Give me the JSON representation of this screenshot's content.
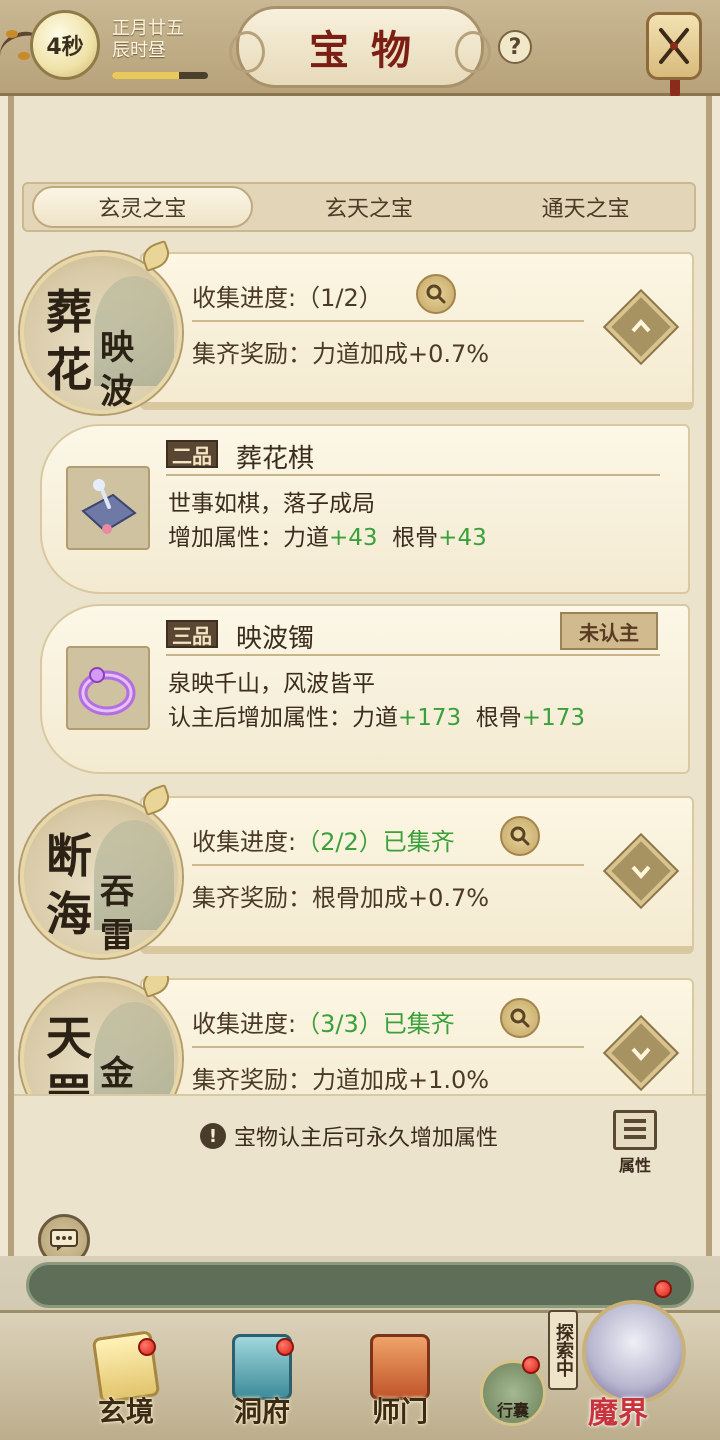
{
  "header": {
    "timer": "4秒",
    "date_line1": "正月廿五",
    "date_line2": "辰时昼",
    "time_progress": 0.7,
    "title": "宝物",
    "help_label": "?"
  },
  "tabs": [
    {
      "label": "玄灵之宝",
      "active": true
    },
    {
      "label": "玄天之宝",
      "active": false
    },
    {
      "label": "通天之宝",
      "active": false
    }
  ],
  "collections": [
    {
      "name_chars": [
        "葬",
        "花",
        "映",
        "波"
      ],
      "progress_label": "收集进度:",
      "progress_value": "（1/2）",
      "complete_text": "",
      "reward_label": "集齐奖励：",
      "reward_value": "力道加成+0.7%",
      "expanded": true
    },
    {
      "name_chars": [
        "断",
        "海",
        "吞",
        "雷"
      ],
      "progress_label": "收集进度:",
      "progress_value": "（2/2）",
      "complete_text": "已集齐",
      "reward_label": "集齐奖励：",
      "reward_value": "根骨加成+0.7%",
      "expanded": false
    },
    {
      "name_chars": [
        "天",
        "罡",
        "金",
        ""
      ],
      "progress_label": "收集进度:",
      "progress_value": "（3/3）",
      "complete_text": "已集齐",
      "reward_label": "集齐奖励：",
      "reward_value": "力道加成+1.0%",
      "expanded": false
    }
  ],
  "items": [
    {
      "grade": "二品",
      "name": "葬花棋",
      "desc": "世事如棋，落子成局",
      "attr_label": "增加属性：",
      "stat1_name": "力道",
      "stat1_val": "+43",
      "stat2_name": "根骨",
      "stat2_val": "+43",
      "status": ""
    },
    {
      "grade": "三品",
      "name": "映波镯",
      "desc": "泉映千山，风波皆平",
      "attr_label": "认主后增加属性：",
      "stat1_name": "力道",
      "stat1_val": "+173",
      "stat2_name": "根骨",
      "stat2_val": "+173",
      "status": "未认主"
    }
  ],
  "footer": {
    "note_icon": "!",
    "note": "宝物认主后可永久增加属性",
    "attr_button": "属性"
  },
  "nav": {
    "items": [
      {
        "label": "玄境",
        "badge": true
      },
      {
        "label": "洞府",
        "badge": true
      },
      {
        "label": "师门",
        "badge": false
      }
    ],
    "bag_label": "行囊",
    "explore_tag": "探索中",
    "demon_label": "魔界"
  },
  "colors": {
    "accent_green": "#3aa03a",
    "title_red": "#7b1e14",
    "badge_red": "#d8231a"
  }
}
